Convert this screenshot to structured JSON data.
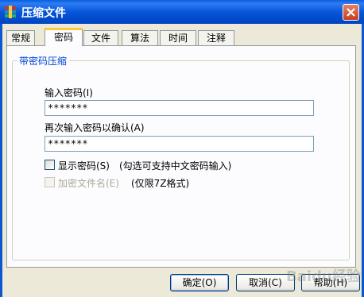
{
  "window": {
    "title": "压缩文件",
    "icon": "archive-icon"
  },
  "tabs": [
    {
      "label": "常规"
    },
    {
      "label": "密码"
    },
    {
      "label": "文件"
    },
    {
      "label": "算法"
    },
    {
      "label": "时间"
    },
    {
      "label": "注释"
    }
  ],
  "active_tab": "密码",
  "group": {
    "title": "带密码压缩"
  },
  "password": {
    "label": "输入密码(I)",
    "value": "*******"
  },
  "confirm": {
    "label": "再次输入密码以确认(A)",
    "value": "*******"
  },
  "show_password": {
    "label": "显示密码(S)",
    "hint": "(勾选可支持中文密码输入)",
    "checked": false
  },
  "encrypt_names": {
    "label": "加密文件名(E)",
    "hint": "(仅限7Z格式)",
    "checked": false,
    "disabled": true
  },
  "buttons": {
    "ok": "确定(O)",
    "cancel": "取消(C)",
    "help": "帮助(H)"
  },
  "watermark": "Baidu经验",
  "colors": {
    "title_bar": "#0A5FE0",
    "group_title": "#0046D5",
    "tab_active_accent": "#FFC83C"
  }
}
